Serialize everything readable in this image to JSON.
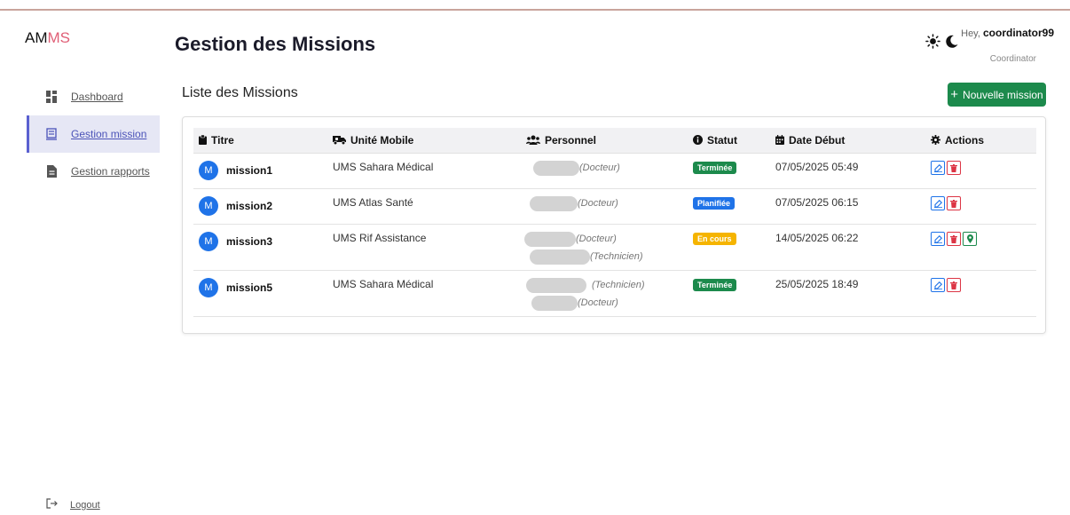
{
  "app": {
    "brand_prefix": "AM",
    "brand_suffix": "MS"
  },
  "sidebar": {
    "items": [
      {
        "label": "Dashboard",
        "icon": "dashboard-icon"
      },
      {
        "label": "Gestion mission",
        "icon": "mission-icon",
        "active": true
      },
      {
        "label": "Gestion rapports",
        "icon": "report-icon"
      }
    ],
    "logout_label": "Logout"
  },
  "header": {
    "title": "Gestion des Missions",
    "greeting": "Hey, ",
    "username": "coordinator99",
    "role": "Coordinator"
  },
  "section": {
    "title": "Liste des Missions",
    "new_button_label": "Nouvelle mission"
  },
  "table": {
    "columns": [
      "Titre",
      "Unité Mobile",
      "Personnel",
      "Statut",
      "Date Début",
      "Actions"
    ],
    "rows": [
      {
        "avatar": "M",
        "title": "mission1",
        "unit": "UMS Sahara Médical",
        "personnel": [
          "(Docteur)"
        ],
        "status": "Terminée",
        "date": "07/05/2025 05:49"
      },
      {
        "avatar": "M",
        "title": "mission2",
        "unit": "UMS Atlas Santé",
        "personnel": [
          "(Docteur)"
        ],
        "status": "Planifiée",
        "date": "07/05/2025 06:15"
      },
      {
        "avatar": "M",
        "title": "mission3",
        "unit": "UMS Rif Assistance",
        "personnel": [
          "(Docteur)",
          "(Technicien)"
        ],
        "status": "En cours",
        "date": "14/05/2025 06:22"
      },
      {
        "avatar": "M",
        "title": "mission5",
        "unit": "UMS Sahara Médical",
        "personnel": [
          "(Technicien)",
          "(Docteur)"
        ],
        "status": "Terminée",
        "date": "25/05/2025 18:49"
      }
    ]
  },
  "colors": {
    "brand_accent": "#e05f76",
    "success": "#1c8a4c",
    "primary": "#1f73e8",
    "warning": "#f5b400",
    "danger": "#dc3545",
    "sidebar_active": "#5a60d0"
  }
}
